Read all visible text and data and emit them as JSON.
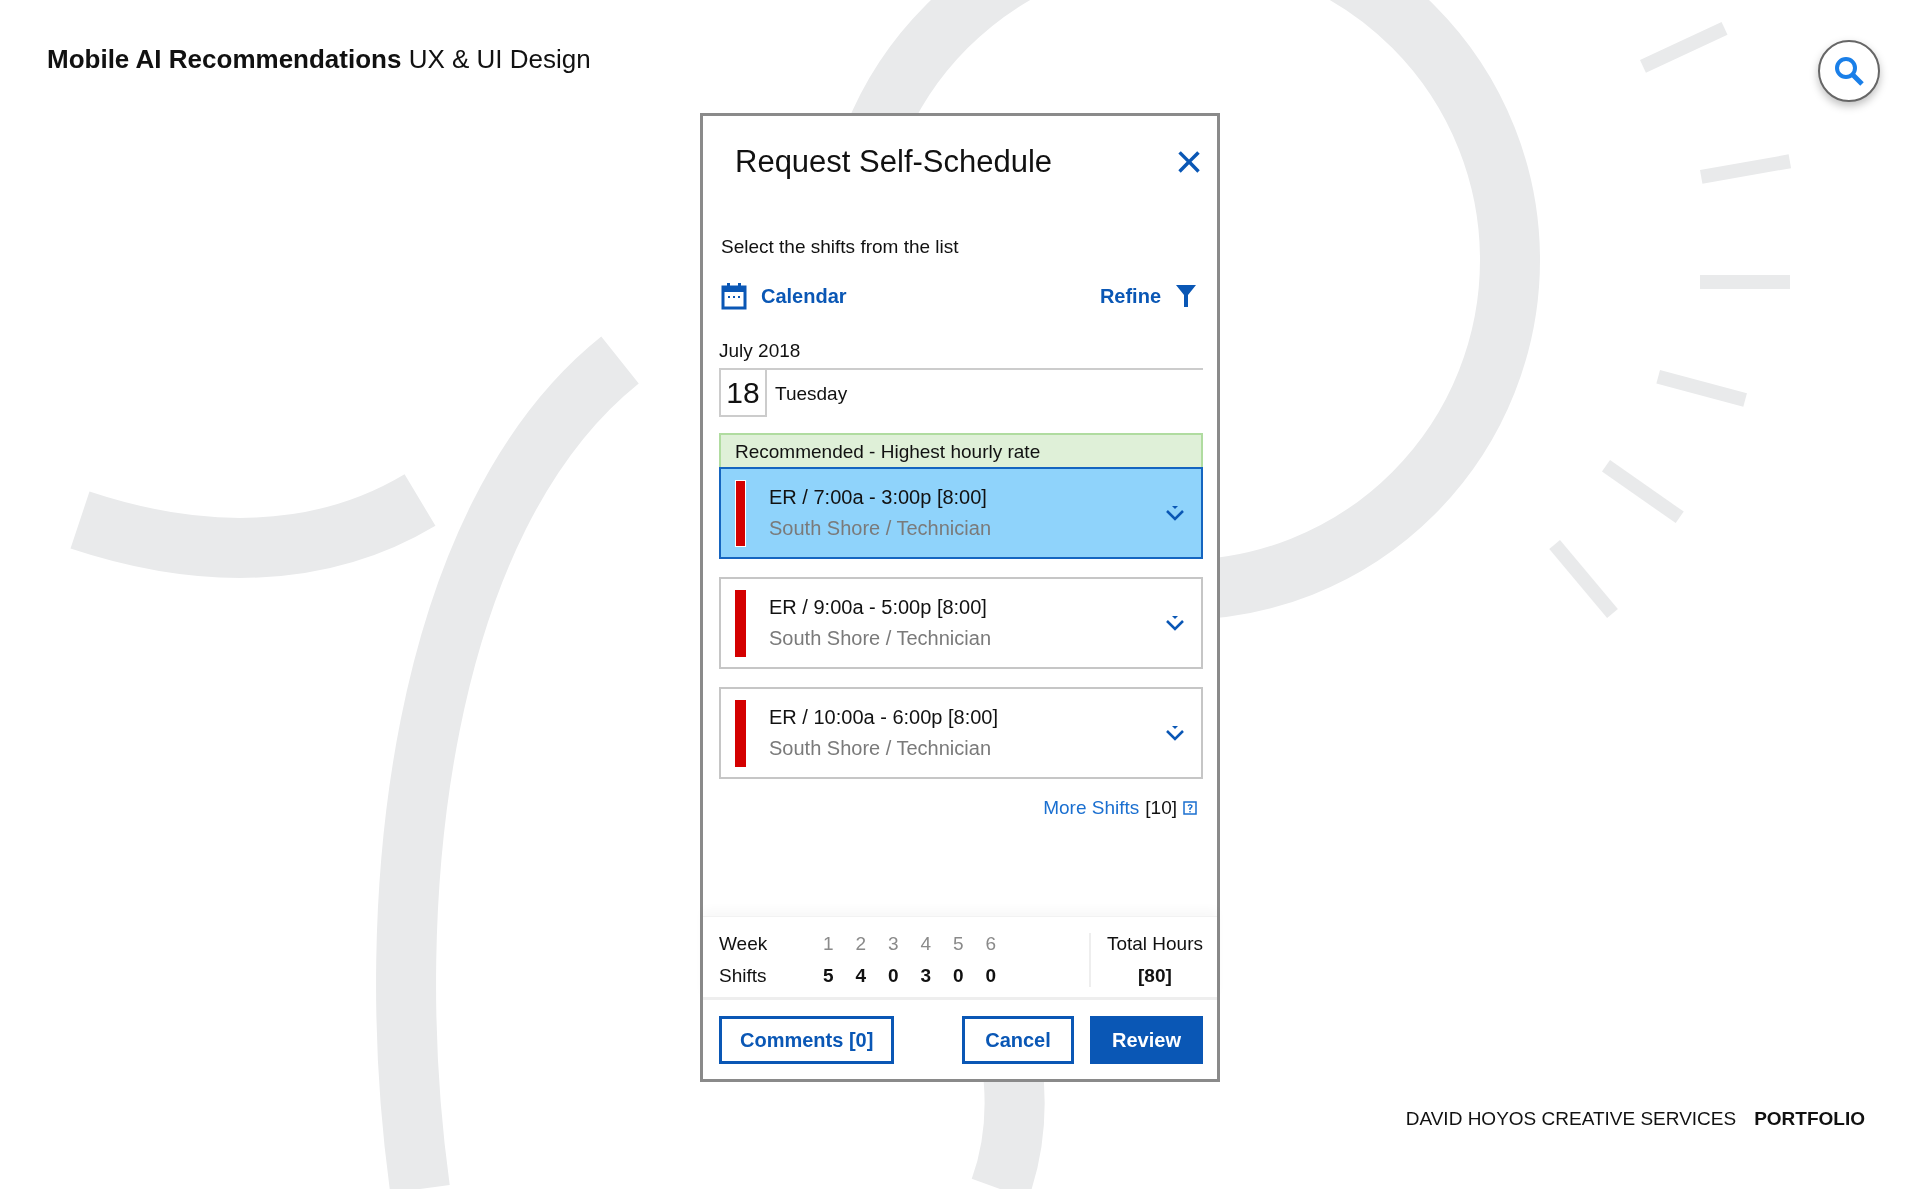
{
  "header": {
    "title_bold": "Mobile AI Recommendations",
    "title_rest": "UX & UI Design"
  },
  "dialog": {
    "title": "Request Self-Schedule",
    "close": "×",
    "instruction": "Select the shifts from the list",
    "calendar_link": "Calendar",
    "refine_link": "Refine",
    "month": "July 2018",
    "day_number": "18",
    "weekday": "Tuesday",
    "recommendation": "Recommended - Highest hourly rate",
    "shifts": [
      {
        "time": "ER / 7:00a - 3:00p [8:00]",
        "location": "South Shore / Technician",
        "selected": true,
        "color": "#d40000"
      },
      {
        "time": "ER / 9:00a - 5:00p [8:00]",
        "location": "South Shore / Technician",
        "selected": false,
        "color": "#d40000"
      },
      {
        "time": "ER / 10:00a - 6:00p [8:00]",
        "location": "South Shore / Technician",
        "selected": false,
        "color": "#d40000"
      }
    ],
    "more_shifts": {
      "label": "More Shifts",
      "count": "[10]"
    },
    "summary": {
      "week_label": "Week",
      "shifts_label": "Shifts",
      "weeks": [
        "1",
        "2",
        "3",
        "4",
        "5",
        "6"
      ],
      "shifts": [
        "5",
        "4",
        "0",
        "3",
        "0",
        "0"
      ],
      "total_label": "Total Hours",
      "total_value": "[80]"
    },
    "buttons": [
      {
        "label": "Comments [0]",
        "kind": "outline"
      },
      {
        "label": "Cancel",
        "kind": "outline"
      },
      {
        "label": "Review",
        "kind": "primary"
      }
    ]
  },
  "footer": {
    "studio": "DAVID HOYOS CREATIVE SERVICES",
    "section": "PORTFOLIO"
  }
}
